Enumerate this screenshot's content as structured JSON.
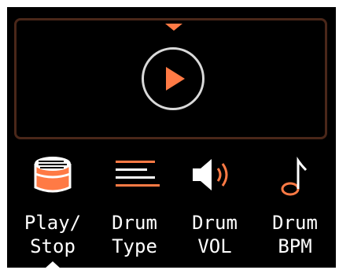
{
  "display": {
    "play_icon": "play-icon",
    "colors": {
      "accent": "#ff7a45",
      "frame": "#4a2719",
      "ring": "#d9d9d9"
    }
  },
  "menu": {
    "selected_index": 0,
    "items": [
      {
        "label": "Play/\nStop",
        "icon": "drum-icon"
      },
      {
        "label": "Drum\nType",
        "icon": "list-icon"
      },
      {
        "label": "Drum\nVOL",
        "icon": "speaker-icon"
      },
      {
        "label": "Drum\nBPM",
        "icon": "music-note-icon"
      }
    ]
  }
}
